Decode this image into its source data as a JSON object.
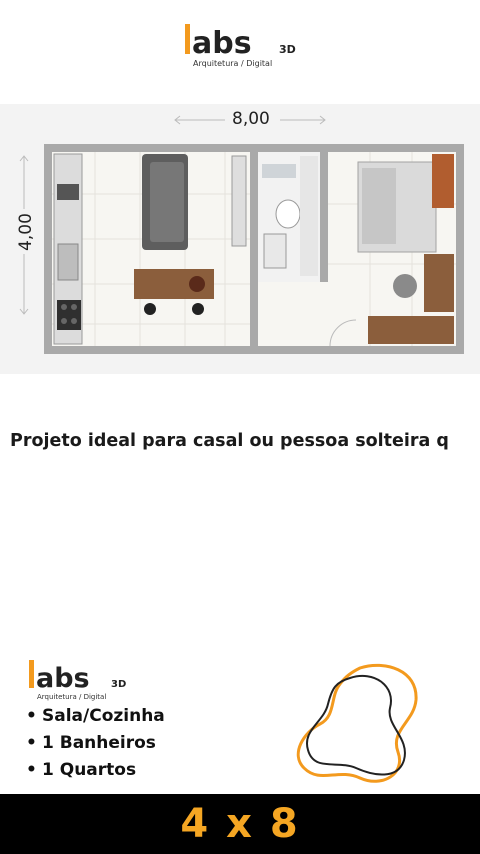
{
  "brand": {
    "name": "labs",
    "suffix": "3D",
    "tagline": "Arquitetura / Digital",
    "accent_color": "#f39a1e"
  },
  "plan": {
    "width_label": "8,00",
    "height_label": "4,00"
  },
  "caption": {
    "text": "Projeto ideal para casal ou pessoa solteira q"
  },
  "features": [
    {
      "bullet": "•",
      "label": "Sala/Cozinha"
    },
    {
      "bullet": "•",
      "label": "1 Banheiros"
    },
    {
      "bullet": "•",
      "label": "1 Quartos"
    }
  ],
  "footer": {
    "size_label": "4 x 8",
    "text_color": "#f5a623",
    "background": "#000000"
  }
}
